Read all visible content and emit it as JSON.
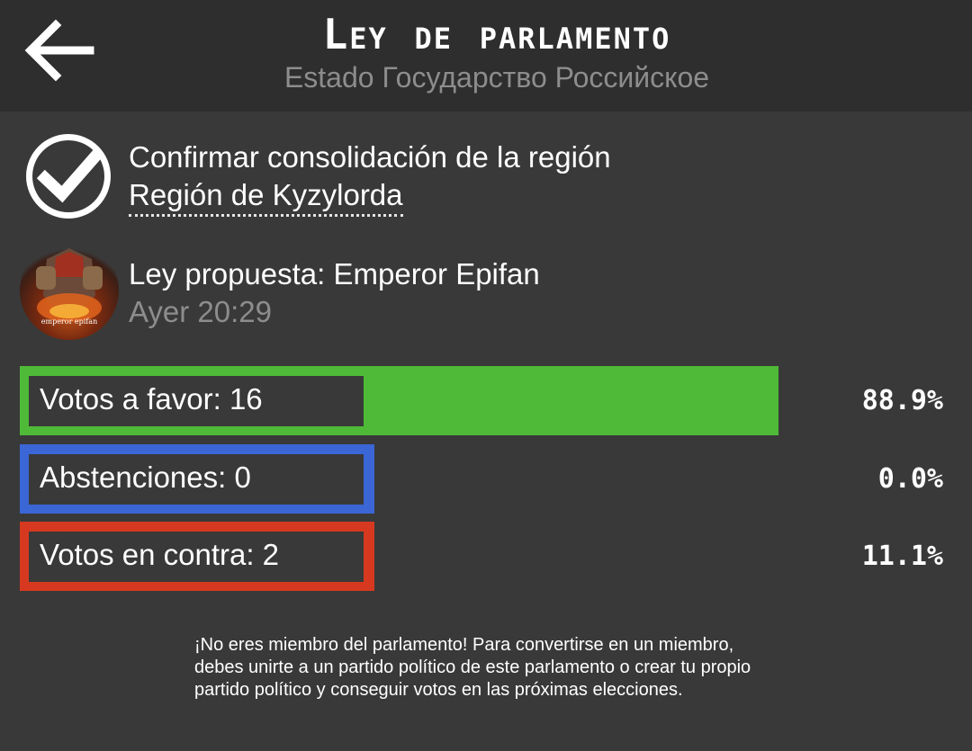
{
  "header": {
    "title": "Ley de parlamento",
    "subtitle": "Estado Государство Российское"
  },
  "law": {
    "title": "Confirmar consolidación de la región",
    "region": "Región de Kyzylorda"
  },
  "proposal": {
    "label": "Ley propuesta: Emperor Epifan",
    "date": "Ayer 20:29",
    "avatar_text": "emperor epifan"
  },
  "votes": [
    {
      "label": "Votos a favor: 16",
      "percent": "88.9%",
      "fraction": 0.889,
      "color": "#4fba38"
    },
    {
      "label": "Abstenciones: 0",
      "percent": "0.0%",
      "fraction": 0.0,
      "color": "#3a66d6"
    },
    {
      "label": "Votos en contra: 2",
      "percent": "11.1%",
      "fraction": 0.111,
      "color": "#d6391f"
    }
  ],
  "notice": "¡No eres miembro del parlamento! Para convertirse en un miembro, debes unirte a un partido político de este parlamento o crear tu propio partido político y conseguir votos en las próximas elecciones."
}
